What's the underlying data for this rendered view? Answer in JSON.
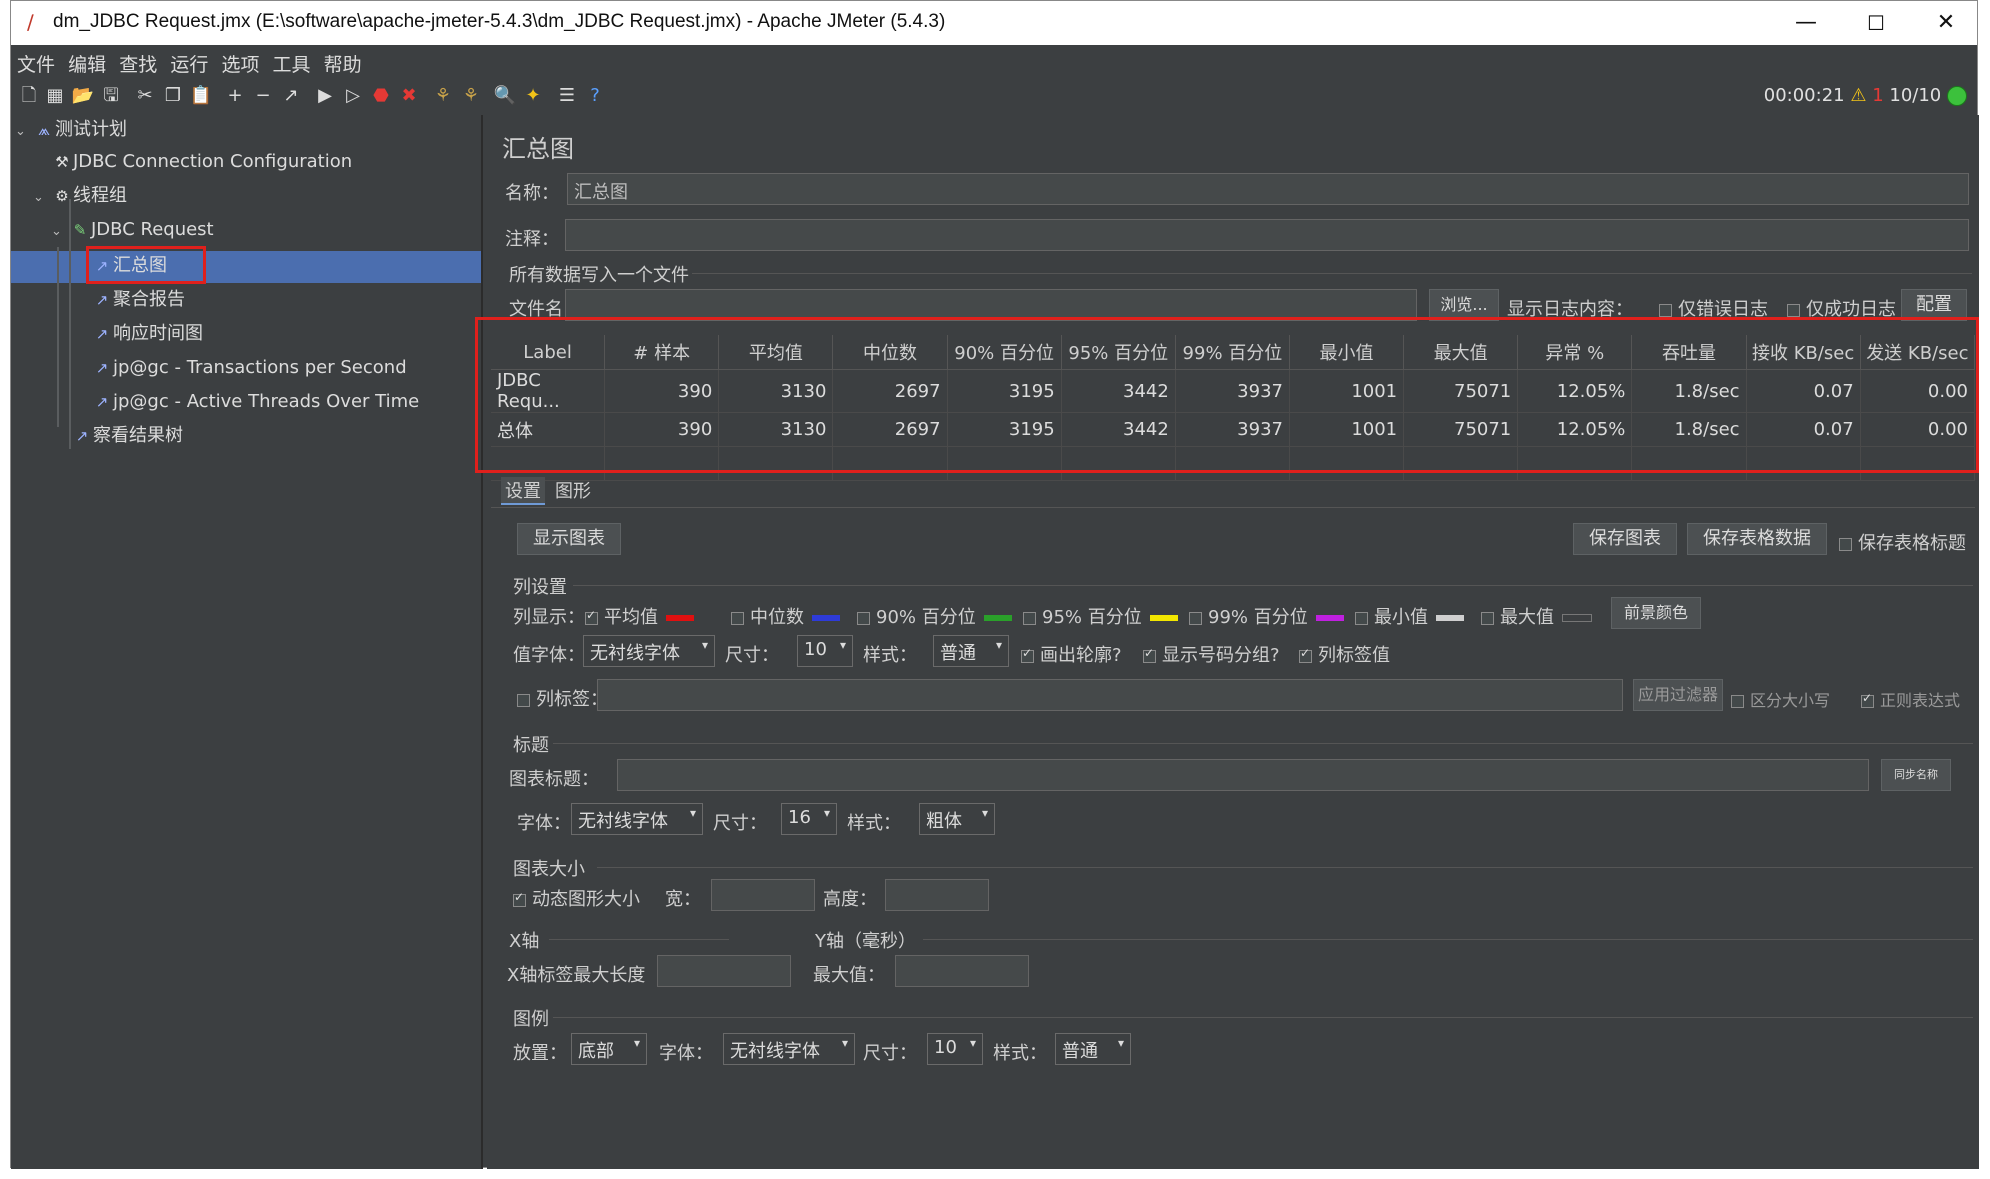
{
  "window": {
    "title": "dm_JDBC Request.jmx (E:\\software\\apache-jmeter-5.4.3\\dm_JDBC Request.jmx) - Apache JMeter (5.4.3)",
    "minimize": "—",
    "maximize": "☐",
    "close": "✕"
  },
  "menu": [
    "文件",
    "编辑",
    "查找",
    "运行",
    "选项",
    "工具",
    "帮助"
  ],
  "status": {
    "time": "00:00:21",
    "warnings": "1",
    "threads": "10/10"
  },
  "tree": [
    {
      "label": "测试计划"
    },
    {
      "label": "JDBC Connection Configuration"
    },
    {
      "label": "线程组"
    },
    {
      "label": "JDBC Request"
    },
    {
      "label": "汇总图"
    },
    {
      "label": "聚合报告"
    },
    {
      "label": "响应时间图"
    },
    {
      "label": "jp@gc - Transactions per Second"
    },
    {
      "label": "jp@gc - Active Threads Over Time"
    },
    {
      "label": "察看结果树"
    }
  ],
  "panel": {
    "heading": "汇总图",
    "name_label": "名称：",
    "name_value": "汇总图",
    "comment_label": "注释：",
    "write_all": "所有数据写入一个文件",
    "filename_label": "文件名",
    "browse": "浏览...",
    "log_content": "显示日志内容：",
    "errors_only": "仅错误日志",
    "success_only": "仅成功日志",
    "config": "配置"
  },
  "table": {
    "headers": [
      "Label",
      "# 样本",
      "平均值",
      "中位数",
      "90% 百分位",
      "95% 百分位",
      "99% 百分位",
      "最小值",
      "最大值",
      "异常 %",
      "吞吐量",
      "接收 KB/sec",
      "发送 KB/sec"
    ],
    "rows": [
      [
        "JDBC Requ...",
        "390",
        "3130",
        "2697",
        "3195",
        "3442",
        "3937",
        "1001",
        "75071",
        "12.05%",
        "1.8/sec",
        "0.07",
        "0.00"
      ],
      [
        "总体",
        "390",
        "3130",
        "2697",
        "3195",
        "3442",
        "3937",
        "1001",
        "75071",
        "12.05%",
        "1.8/sec",
        "0.07",
        "0.00"
      ]
    ]
  },
  "tabs": {
    "settings": "设置",
    "graph": "图形"
  },
  "buttons": {
    "show_graph": "显示图表",
    "save_graph": "保存图表",
    "save_table": "保存表格数据",
    "save_header": "保存表格标题"
  },
  "columns": {
    "section": "列设置",
    "display_label": "列显示：",
    "items": [
      {
        "label": "平均值",
        "checked": true,
        "color": "#e01010"
      },
      {
        "label": "中位数",
        "checked": false,
        "color": "#2e3bd8"
      },
      {
        "label": "90% 百分位",
        "checked": false,
        "color": "#2aa02a"
      },
      {
        "label": "95% 百分位",
        "checked": false,
        "color": "#f2e600"
      },
      {
        "label": "99% 百分位",
        "checked": false,
        "color": "#c020e0"
      },
      {
        "label": "最小值",
        "checked": false,
        "color": "#cfcfcf"
      },
      {
        "label": "最大值",
        "checked": false,
        "color": "#3c3f41"
      }
    ],
    "fg_color": "前景颜色",
    "value_font_label": "值字体：",
    "value_font": "无衬线字体",
    "size_label": "尺寸：",
    "value_size": "10",
    "style_label": "样式：",
    "value_style": "普通",
    "draw_outline": "画出轮廓?",
    "show_grouping": "显示号码分组?",
    "label_values": "列标签值",
    "col_label": "列标签：",
    "apply_filter": "应用过滤器",
    "case_sensitive": "区分大小写",
    "regex": "正则表达式"
  },
  "title_section": {
    "section": "标题",
    "chart_title_label": "图表标题：",
    "sync_name": "同步名称",
    "font_label": "字体：",
    "font": "无衬线字体",
    "size_label": "尺寸：",
    "size": "16",
    "style_label": "样式：",
    "style": "粗体"
  },
  "size_section": {
    "section": "图表大小",
    "dynamic": "动态图形大小",
    "width_label": "宽：",
    "height_label": "高度："
  },
  "axis": {
    "x_section": "X轴",
    "y_section": "Y轴（毫秒）",
    "x_maxlen_label": "X轴标签最大长度",
    "max_label": "最大值："
  },
  "legend": {
    "section": "图例",
    "placement_label": "放置：",
    "placement": "底部",
    "font_label": "字体：",
    "font": "无衬线字体",
    "size_label": "尺寸：",
    "size": "10",
    "style_label": "样式：",
    "style": "普通"
  }
}
